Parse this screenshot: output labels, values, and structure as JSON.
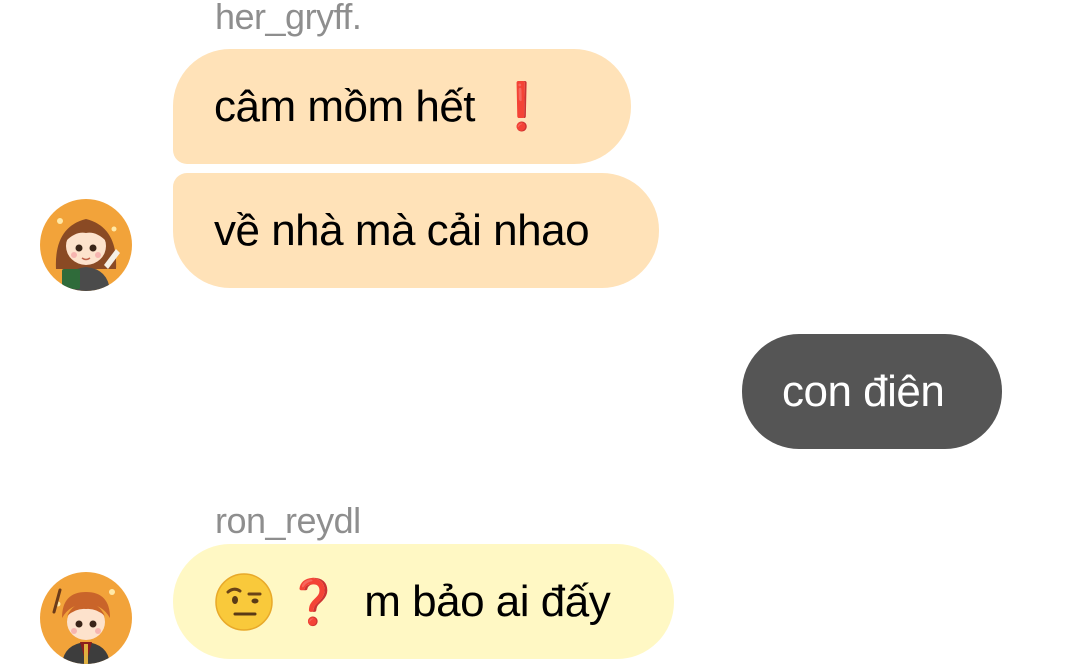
{
  "thread": {
    "groups": [
      {
        "sender": "her_gryff.",
        "bubble_color": "#ffe2b8",
        "messages": [
          {
            "text": "câm mồm hết",
            "trailing_icon": "red-exclamation"
          },
          {
            "text": "về nhà mà cải nhao"
          }
        ]
      },
      {
        "outgoing": true,
        "bubble_color": "#555555",
        "text_color": "#ffffff",
        "messages": [
          {
            "text": "con điên"
          }
        ]
      },
      {
        "sender": "ron_reydl",
        "bubble_color": "#fff8c4",
        "messages": [
          {
            "leading_icons": [
              "raised-eyebrow-emoji",
              "red-question-mark"
            ],
            "text": "m bảo ai đấy"
          }
        ]
      }
    ]
  },
  "icons": {
    "exclamation": "❗",
    "question": "❓"
  }
}
